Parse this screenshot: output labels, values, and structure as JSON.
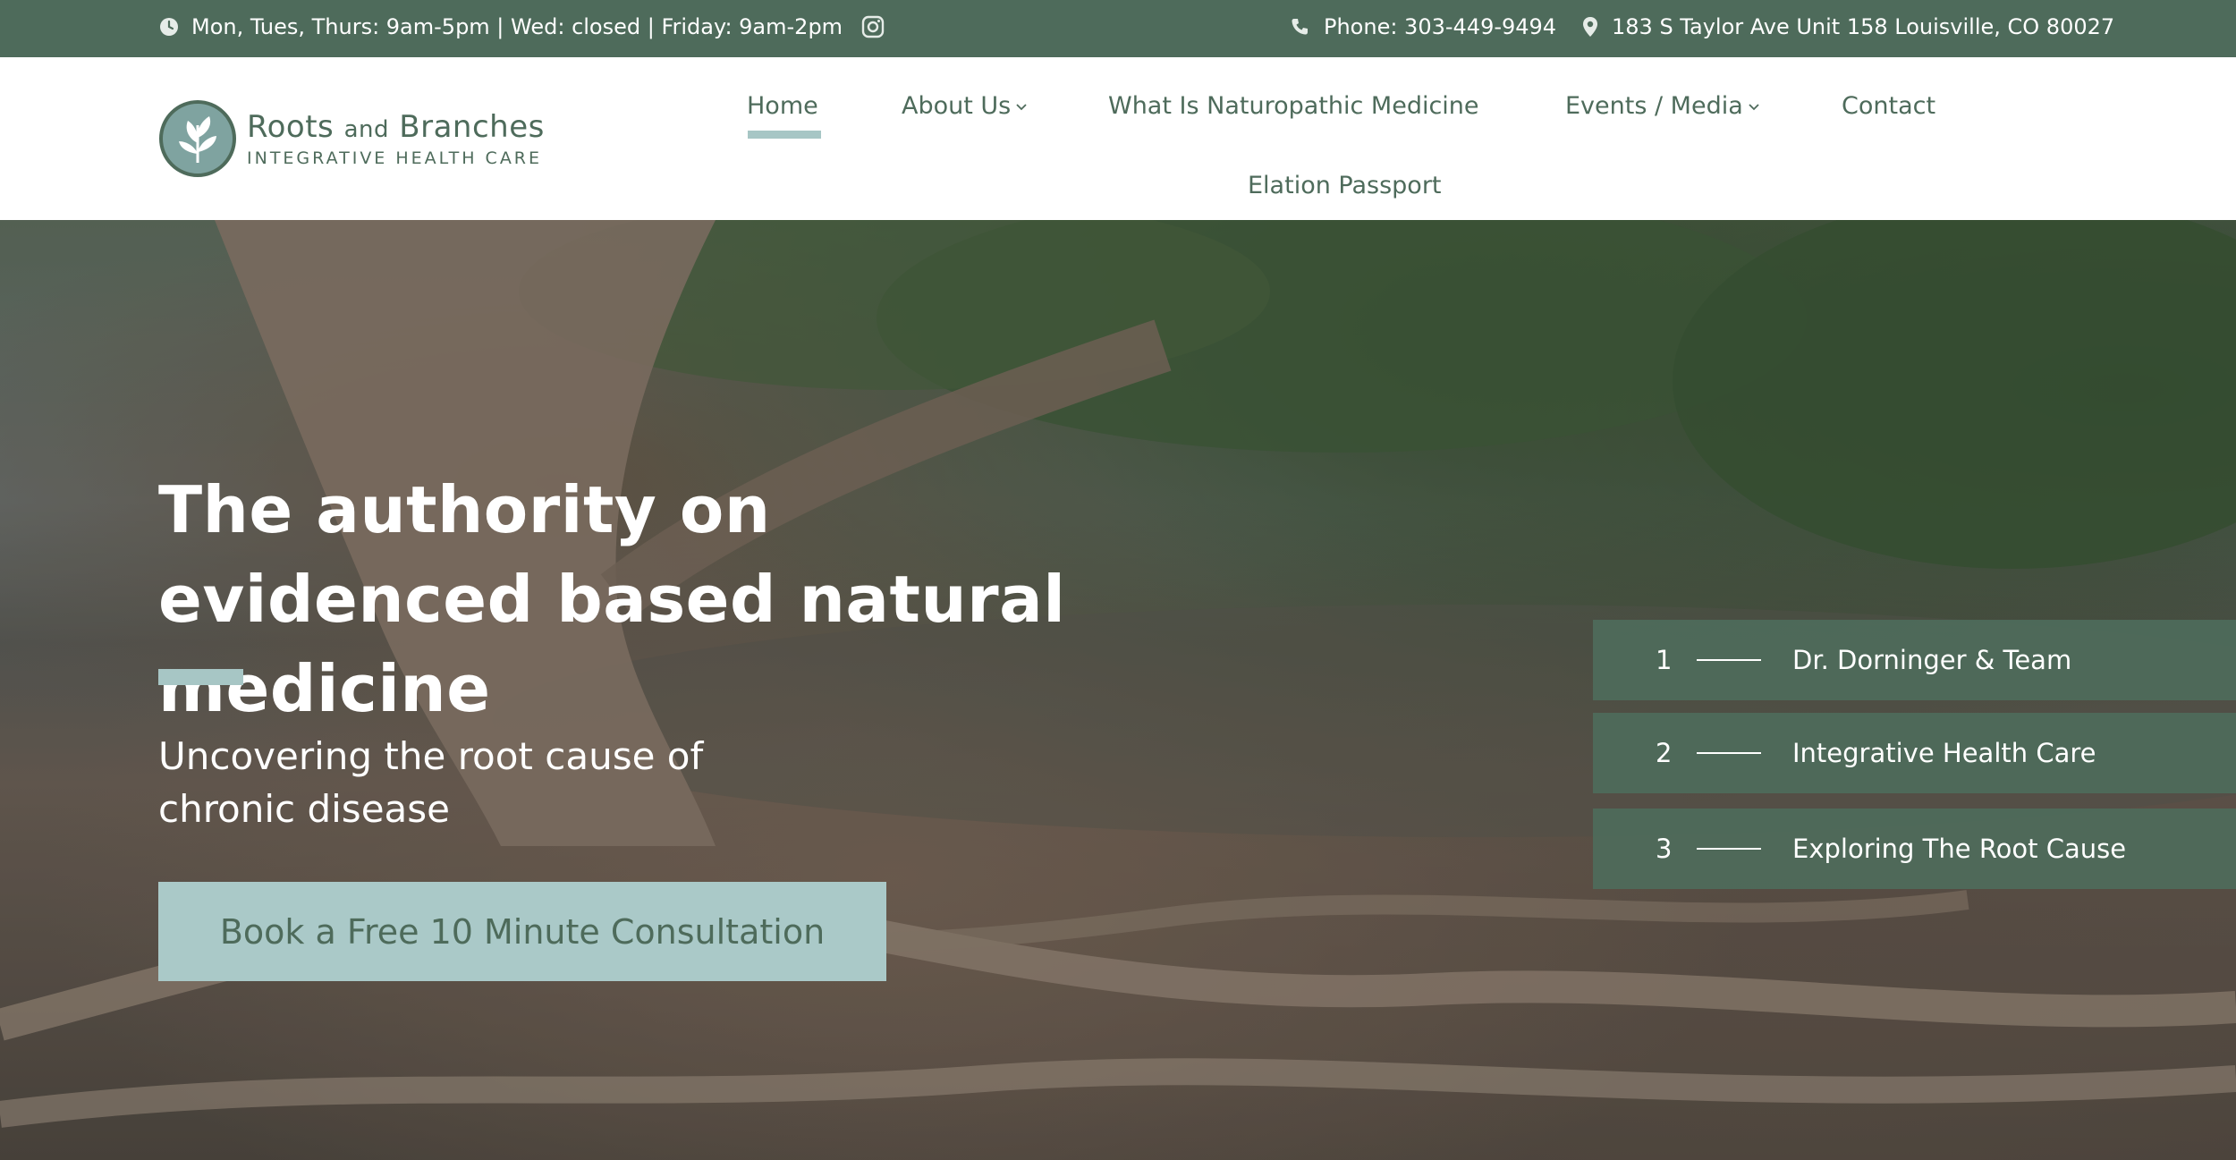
{
  "topbar": {
    "hours": "Mon, Tues, Thurs: 9am-5pm | Wed: closed | Friday: 9am-2pm",
    "instagram_icon": "instagram-icon",
    "phone": "Phone: 303-449-9494",
    "address": "183 S Taylor Ave Unit 158 Louisville, CO 80027"
  },
  "logo": {
    "name_a": "Roots ",
    "name_b": "and",
    "name_c": " Branches",
    "tagline": "INTEGRATIVE HEALTH CARE"
  },
  "nav": {
    "home": "Home",
    "about": "About Us",
    "naturopathic": "What Is Naturopathic Medicine",
    "events": "Events / Media",
    "contact": "Contact",
    "elation": "Elation Passport"
  },
  "hero": {
    "title": "The authority on evidenced based natural medicine",
    "subtitle": "Uncovering the root cause of chronic disease",
    "cta": "Book a Free 10 Minute Consultation"
  },
  "slides": [
    {
      "num": "1",
      "label": "Dr. Dorninger & Team"
    },
    {
      "num": "2",
      "label": "Integrative Health Care"
    },
    {
      "num": "3",
      "label": "Exploring The Root Cause"
    }
  ],
  "colors": {
    "brand_green": "#4e6b5b",
    "accent_teal": "#a7c6c5"
  }
}
